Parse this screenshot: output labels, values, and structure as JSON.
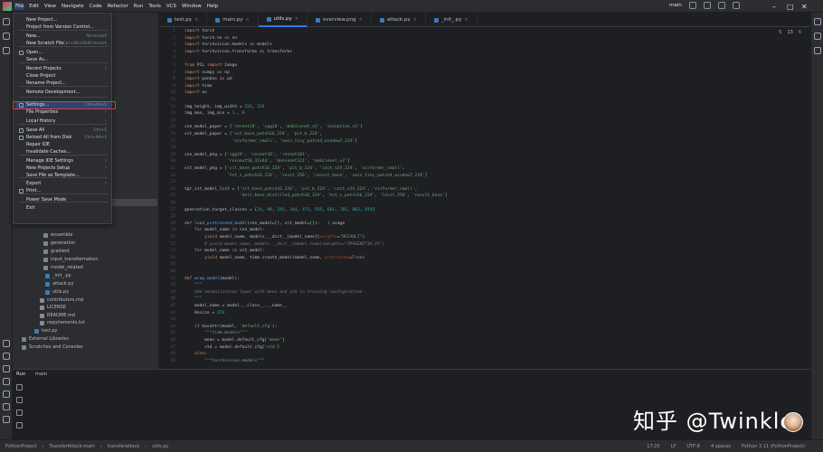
{
  "menubar": {
    "items": [
      "File",
      "Edit",
      "View",
      "Navigate",
      "Code",
      "Refactor",
      "Run",
      "Tools",
      "VCS",
      "Window",
      "Help"
    ],
    "branch": "main"
  },
  "file_menu": {
    "items": [
      {
        "label": "New Project...",
        "shortcut": ""
      },
      {
        "label": "Project from Version Control...",
        "shortcut": ""
      },
      {
        "label": "New...",
        "shortcut": "Alt+Insert"
      },
      {
        "label": "New Scratch File",
        "shortcut": "Ctrl+Alt+Shift+Insert"
      },
      {
        "label": "Open...",
        "shortcut": ""
      },
      {
        "label": "Save As...",
        "shortcut": ""
      },
      {
        "label": "Recent Projects",
        "shortcut": ""
      },
      {
        "label": "Close Project",
        "shortcut": ""
      },
      {
        "label": "Rename Project...",
        "shortcut": ""
      },
      {
        "label": "Remote Development...",
        "shortcut": ""
      },
      {
        "label": "Settings...",
        "shortcut": "Ctrl+Alt+S"
      },
      {
        "label": "File Properties",
        "shortcut": ""
      },
      {
        "label": "Local History",
        "shortcut": ""
      },
      {
        "label": "Save All",
        "shortcut": "Ctrl+S"
      },
      {
        "label": "Reload All from Disk",
        "shortcut": "Ctrl+Alt+Y"
      },
      {
        "label": "Repair IDE",
        "shortcut": ""
      },
      {
        "label": "Invalidate Caches...",
        "shortcut": ""
      },
      {
        "label": "Manage IDE Settings",
        "shortcut": ""
      },
      {
        "label": "New Projects Setup",
        "shortcut": ""
      },
      {
        "label": "Save File as Template...",
        "shortcut": ""
      },
      {
        "label": "Export",
        "shortcut": ""
      },
      {
        "label": "Print...",
        "shortcut": ""
      },
      {
        "label": "Power Save Mode",
        "shortcut": ""
      },
      {
        "label": "Exit",
        "shortcut": ""
      }
    ]
  },
  "tabs": [
    {
      "label": "test.py",
      "active": false
    },
    {
      "label": "main.py",
      "active": false
    },
    {
      "label": "utils.py",
      "active": true
    },
    {
      "label": "overview.png",
      "active": false
    },
    {
      "label": "attack.py",
      "active": false
    },
    {
      "label": "_init_.py",
      "active": false
    }
  ],
  "inspections": {
    "warnings": "5",
    "weak": "13",
    "ok": "6"
  },
  "project_tree": [
    {
      "label": "ensemble",
      "type": "folder"
    },
    {
      "label": "generation",
      "type": "folder"
    },
    {
      "label": "gradient",
      "type": "folder"
    },
    {
      "label": "input_transformation",
      "type": "folder"
    },
    {
      "label": "model_related",
      "type": "folder"
    },
    {
      "label": "_init_.py",
      "type": "py"
    },
    {
      "label": "attack.py",
      "type": "py"
    },
    {
      "label": "utils.py",
      "type": "py"
    },
    {
      "label": "contributors.md",
      "type": "md"
    },
    {
      "label": "LICENSE",
      "type": "md"
    },
    {
      "label": "README.md",
      "type": "md"
    },
    {
      "label": "requirements.txt",
      "type": "md"
    },
    {
      "label": "test.py",
      "type": "py"
    },
    {
      "label": "External Libraries",
      "type": "folder"
    },
    {
      "label": "Scratches and Consoles",
      "type": "folder"
    }
  ],
  "code_lines": [
    {
      "n": "1",
      "code": "import torch"
    },
    {
      "n": "2",
      "code": "import torch.nn as nn"
    },
    {
      "n": "3",
      "code": "import torchvision.models as models"
    },
    {
      "n": "4",
      "code": "import torchvision.transforms as transforms"
    },
    {
      "n": "5",
      "code": ""
    },
    {
      "n": "6",
      "code": "from PIL import Image"
    },
    {
      "n": "7",
      "code": "import numpy as np"
    },
    {
      "n": "8",
      "code": "import pandas as pd"
    },
    {
      "n": "9",
      "code": "import time"
    },
    {
      "n": "10",
      "code": "import os"
    },
    {
      "n": "11",
      "code": ""
    },
    {
      "n": "12",
      "code": "img_height, img_width = 224, 224"
    },
    {
      "n": "13",
      "code": "img_max, img_min = 1., 0"
    },
    {
      "n": "14",
      "code": ""
    },
    {
      "n": "15",
      "code": "cnn_model_paper = ['resnet18', 'vgg16', 'mobilenet_v2', 'inception_v3']"
    },
    {
      "n": "16",
      "code": "vit_model_paper = ['vit_base_patch16_224', 'pit_b_224',"
    },
    {
      "n": "17",
      "code": "                   'visformer_small', 'swin_tiny_patch4_window7_224']"
    },
    {
      "n": "18",
      "code": ""
    },
    {
      "n": "19",
      "code": "cnn_model_pkg = ['vgg19', 'resnet18', 'resnet101',"
    },
    {
      "n": "20",
      "code": "                 'resnext50_32x4d', 'densenet121', 'mobilenet_v2']"
    },
    {
      "n": "21",
      "code": "vit_model_pkg = ['vit_base_patch16_224', 'pit_b_224', 'cait_s24_224', 'visformer_small',"
    },
    {
      "n": "22",
      "code": "                 'tnt_s_patch16_224', 'levit_256', 'convit_base', 'swin_tiny_patch4_window7_224']"
    },
    {
      "n": "23",
      "code": ""
    },
    {
      "n": "24",
      "code": "tgr_vit_model_list = ['vit_base_patch16_224', 'pit_b_224', 'cait_s24_224', 'visformer_small',"
    },
    {
      "n": "25",
      "code": "                      'deit_base_distilled_patch16_224', 'tnt_s_patch16_224', 'levit_256', 'convit_base']"
    },
    {
      "n": "26",
      "code": ""
    },
    {
      "n": "27",
      "code": "generation_target_classes = [24, 99, 245, 344, 471, 555, 661, 701, 802, 919]"
    },
    {
      "n": "28",
      "code": ""
    },
    {
      "n": "29",
      "code": "def load_pretrained_model(cnn_model=[], vit_model=[]):   1 usage"
    },
    {
      "n": "30",
      "code": "    for model_name in cnn_model:"
    },
    {
      "n": "31",
      "code": "        yield model_name, models.__dict__[model_name](weights=\"DEFAULT\")"
    },
    {
      "n": "32",
      "code": "        # yield model_name, models.__dict__[model_name](weights=\"IMAGENET1K_V1\")"
    },
    {
      "n": "33",
      "code": "    for model_name in vit_model:"
    },
    {
      "n": "34",
      "code": "        yield model_name, timm.create_model(model_name, pretrained=True)"
    },
    {
      "n": "35",
      "code": ""
    },
    {
      "n": "36",
      "code": ""
    },
    {
      "n": "37",
      "code": "def wrap_model(model):"
    },
    {
      "n": "38",
      "code": "    \"\"\""
    },
    {
      "n": "39",
      "code": "    Add normalization layer with mean and std in training configuration"
    },
    {
      "n": "40",
      "code": "    \"\"\""
    },
    {
      "n": "41",
      "code": "    model_name = model.__class__.__name__"
    },
    {
      "n": "42",
      "code": "    Resize = 224"
    },
    {
      "n": "43",
      "code": ""
    },
    {
      "n": "44",
      "code": "    if hasattr(model, 'default_cfg'):"
    },
    {
      "n": "45",
      "code": "        \"\"\"timm.models\"\"\""
    },
    {
      "n": "46",
      "code": "        mean = model.default_cfg['mean']"
    },
    {
      "n": "47",
      "code": "        std = model.default_cfg['std']"
    },
    {
      "n": "48",
      "code": "    else:"
    },
    {
      "n": "49",
      "code": "        \"\"\"torchvision.models\"\"\""
    }
  ],
  "run_panel": {
    "tab": "Run",
    "config": "main"
  },
  "statusbar": {
    "crumbs": [
      "PythonProject",
      "TransferAttack-main",
      "transferattack",
      "utils.py"
    ],
    "position": "17:25",
    "line_sep": "LF",
    "encoding": "UTF-8",
    "indent": "4 spaces",
    "interpreter": "Python 3.11 (PythonProject)"
  },
  "watermark": "知乎 @Twinkle"
}
